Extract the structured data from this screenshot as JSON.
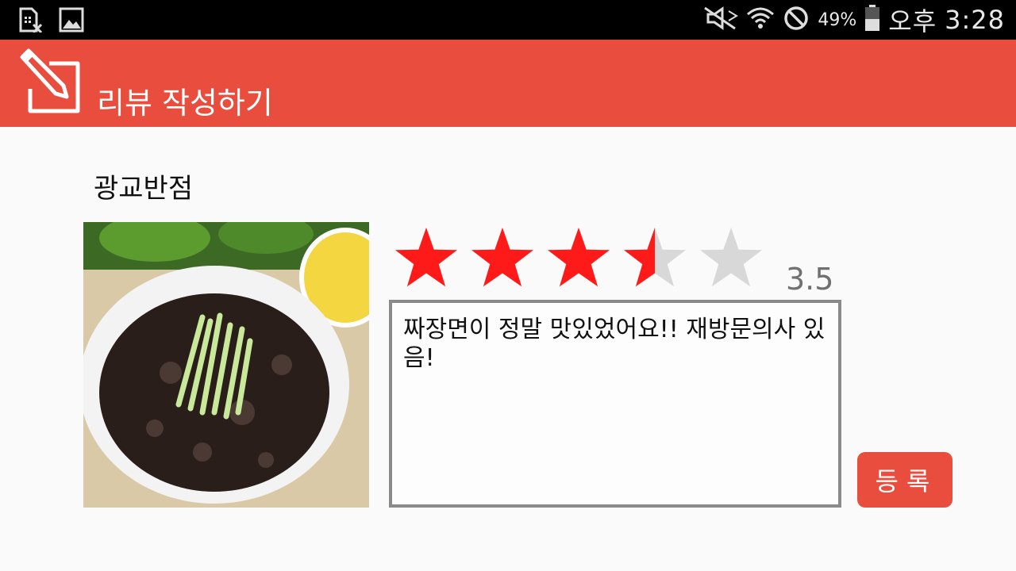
{
  "status_bar": {
    "battery_percent": "49%",
    "ampm": "오후",
    "time": "3:28",
    "icons": [
      "sim-error-icon",
      "gallery-icon",
      "mute-icon",
      "wifi-icon",
      "blocked-icon",
      "battery-icon"
    ]
  },
  "app_bar": {
    "title": "리뷰 작성하기",
    "icon": "edit-note-icon",
    "color": "#e84d3d"
  },
  "restaurant": {
    "name": "광교반점"
  },
  "review": {
    "rating": 3.5,
    "rating_max": 5,
    "rating_label": "3.5",
    "star_color": "#ff1a1a",
    "star_empty_color": "#d8d8d8",
    "text": "짜장면이 정말 맛있었어요!! 재방문의사 있음!"
  },
  "submit": {
    "label": "등록"
  }
}
